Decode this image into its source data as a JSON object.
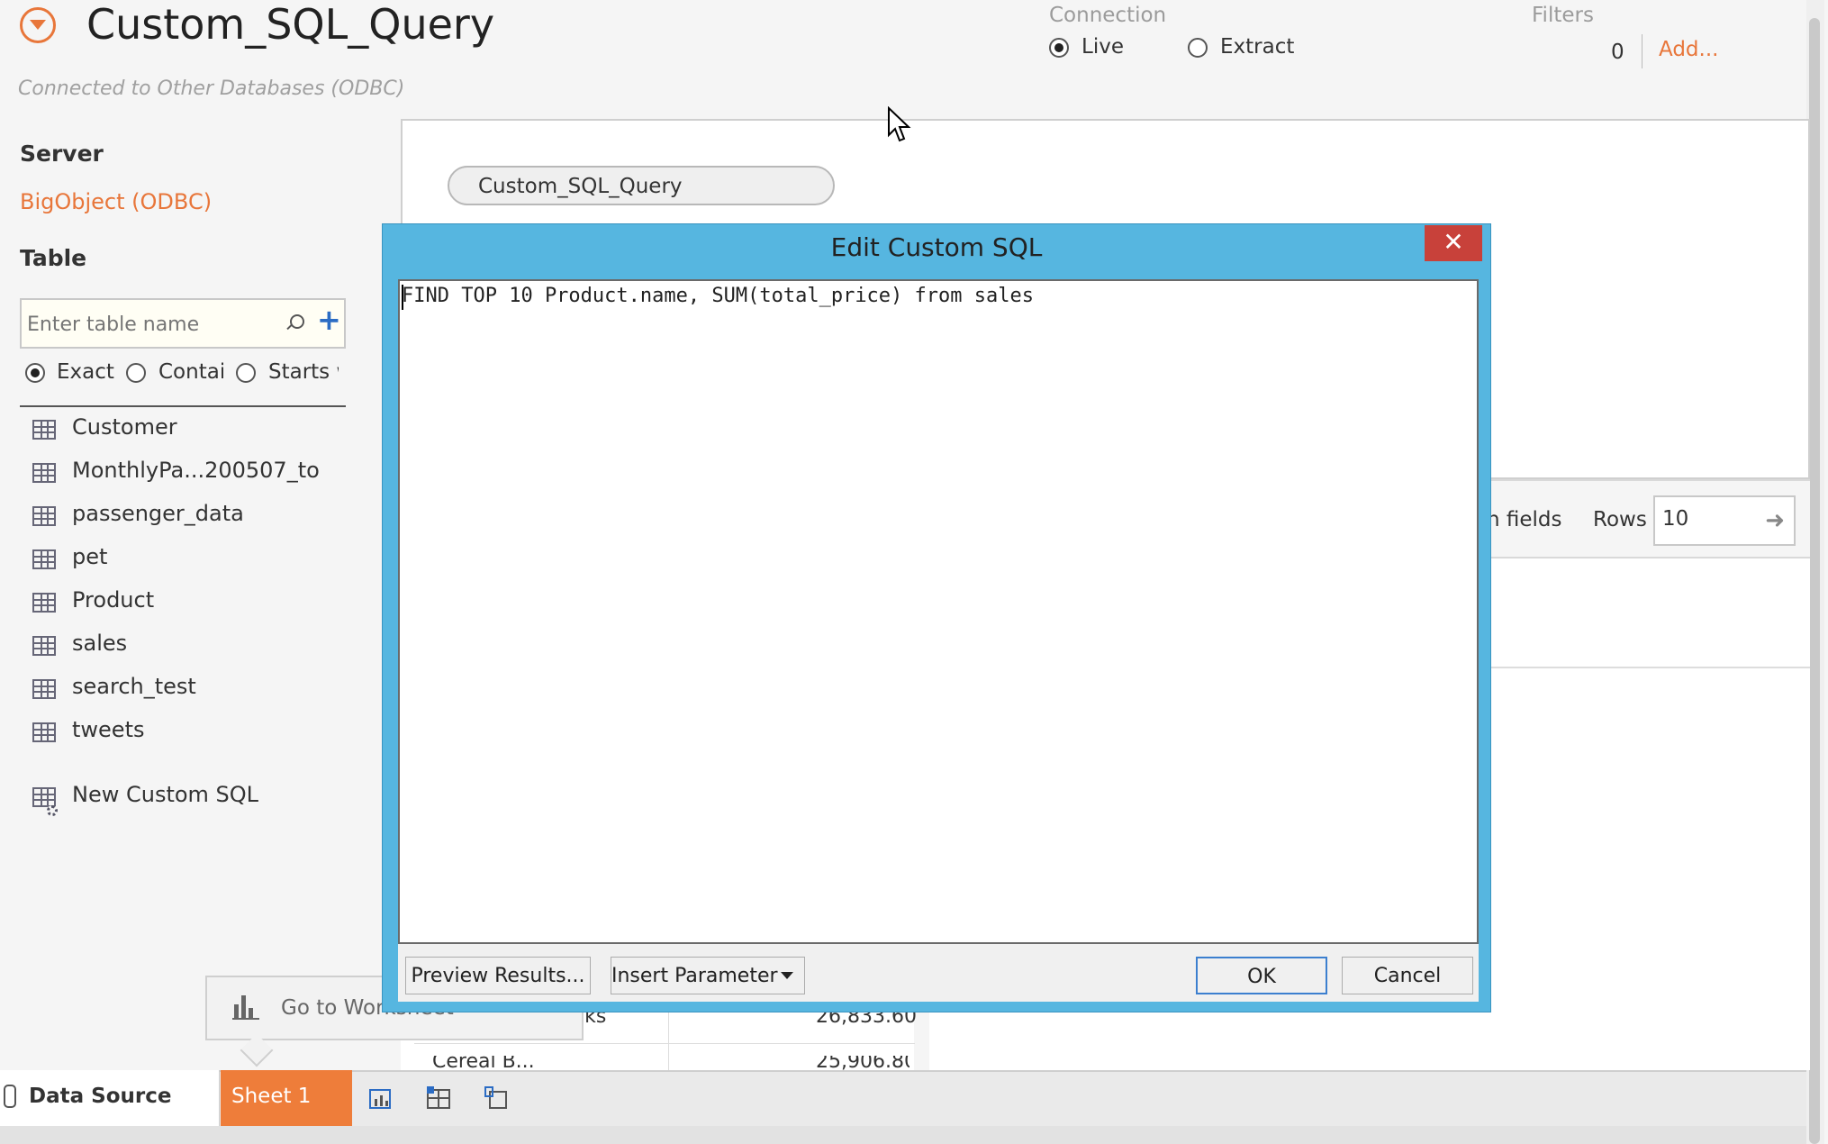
{
  "header": {
    "title": "Custom_SQL_Query",
    "subtitle": "Connected to Other Databases (ODBC)",
    "connection": {
      "label": "Connection",
      "options": [
        "Live",
        "Extract"
      ],
      "selected": "Live"
    },
    "filters": {
      "label": "Filters",
      "count": "0",
      "add_label": "Add..."
    }
  },
  "sidebar": {
    "server_heading": "Server",
    "server_name": "BigObject (ODBC)",
    "table_heading": "Table",
    "search_placeholder": "Enter table name",
    "match_options": [
      "Exact",
      "Contain",
      "Starts w"
    ],
    "match_selected": "Exact",
    "tables": [
      "Customer",
      "MonthlyPa...200507_to",
      "passenger_data",
      "pet",
      "Product",
      "sales",
      "search_test",
      "tweets"
    ],
    "new_custom_sql": "New Custom SQL"
  },
  "canvas": {
    "query_pill": "Custom_SQL_Query",
    "hidden_fields_label": "n fields",
    "rows_label": "Rows",
    "rows_value": "10"
  },
  "grid": {
    "row1_name": "igrain Snacks",
    "row1_value": "26,833.60",
    "row2_name": "Cereal  B...",
    "row2_value": "25,906.80"
  },
  "tooltip": {
    "label": "Go to Worksheet"
  },
  "tabs": {
    "data_source": "Data Source",
    "sheet1": "Sheet 1"
  },
  "dialog": {
    "title": "Edit Custom SQL",
    "close_glyph": "✕",
    "sql": "FIND TOP 10 Product.name, SUM(total_price) from sales",
    "preview_button": "Preview Results...",
    "insert_parameter_button": "Insert Parameter",
    "ok_button": "OK",
    "cancel_button": "Cancel"
  },
  "colors": {
    "accent": "#e8763a",
    "dialog_frame": "#56b6e0",
    "close_red": "#c8413a",
    "link_blue": "#2b6cc4"
  },
  "icons": [
    "datasource-dropdown-icon",
    "search-icon",
    "add-icon",
    "table-icon",
    "custom-sql-icon",
    "bars-chart-icon",
    "database-icon",
    "new-worksheet-icon",
    "new-dashboard-icon",
    "new-story-icon",
    "close-icon",
    "arrow-right-icon",
    "mouse-cursor-icon"
  ]
}
